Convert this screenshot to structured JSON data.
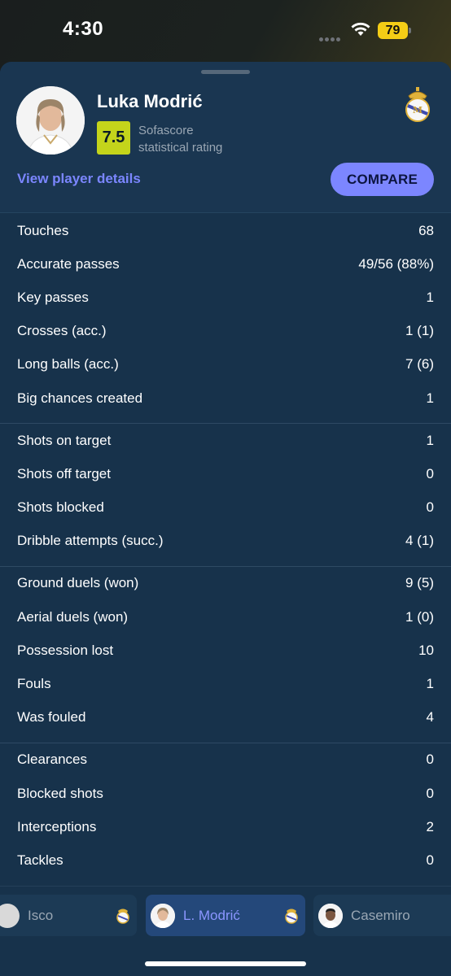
{
  "status_bar": {
    "time": "4:30",
    "battery": "79"
  },
  "player": {
    "name": "Luka Modrić",
    "rating": "7.5",
    "rating_label_line1": "Sofascore",
    "rating_label_line2": "statistical rating",
    "details_link": "View player details",
    "compare_button": "COMPARE"
  },
  "stat_groups": [
    [
      {
        "label": "Touches",
        "value": "68"
      },
      {
        "label": "Accurate passes",
        "value": "49/56 (88%)"
      },
      {
        "label": "Key passes",
        "value": "1"
      },
      {
        "label": "Crosses (acc.)",
        "value": "1 (1)"
      },
      {
        "label": "Long balls (acc.)",
        "value": "7 (6)"
      },
      {
        "label": "Big chances created",
        "value": "1"
      }
    ],
    [
      {
        "label": "Shots on target",
        "value": "1"
      },
      {
        "label": "Shots off target",
        "value": "0"
      },
      {
        "label": "Shots blocked",
        "value": "0"
      },
      {
        "label": "Dribble attempts (succ.)",
        "value": "4 (1)"
      }
    ],
    [
      {
        "label": "Ground duels (won)",
        "value": "9 (5)"
      },
      {
        "label": "Aerial duels (won)",
        "value": "1 (0)"
      },
      {
        "label": "Possession lost",
        "value": "10"
      },
      {
        "label": "Fouls",
        "value": "1"
      },
      {
        "label": "Was fouled",
        "value": "4"
      }
    ],
    [
      {
        "label": "Clearances",
        "value": "0"
      },
      {
        "label": "Blocked shots",
        "value": "0"
      },
      {
        "label": "Interceptions",
        "value": "2"
      },
      {
        "label": "Tackles",
        "value": "0"
      }
    ]
  ],
  "player_tabs": [
    {
      "name": "Isco",
      "active": false
    },
    {
      "name": "L. Modrić",
      "active": true
    },
    {
      "name": "Casemiro",
      "active": false
    }
  ],
  "colors": {
    "sheet_bg": "#17324b",
    "accent": "#7c86ff",
    "rating": "#c4d41b"
  }
}
